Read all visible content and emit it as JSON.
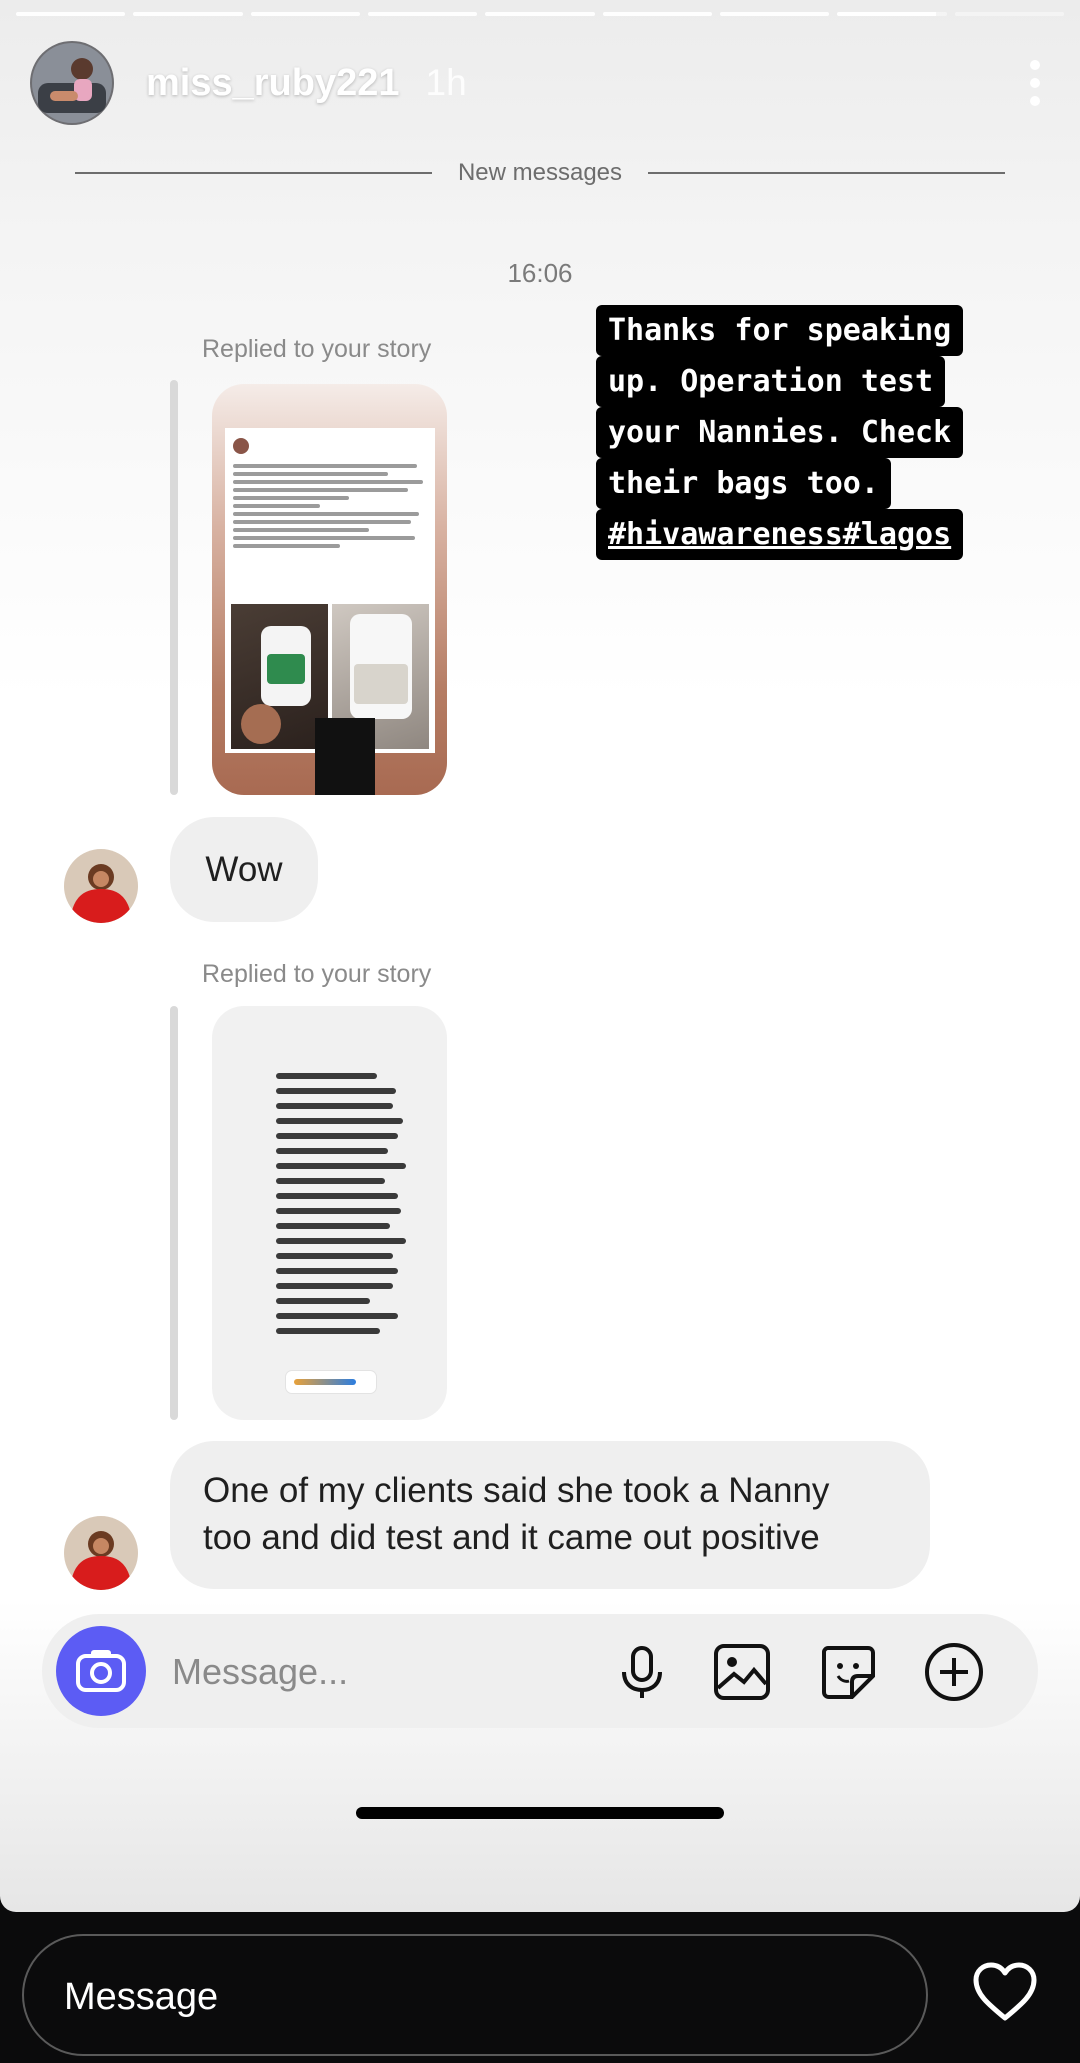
{
  "story": {
    "username": "miss_ruby221",
    "time": "1h",
    "segments": [
      "seen",
      "seen",
      "seen",
      "seen",
      "seen",
      "seen",
      "seen",
      "partial",
      "unseen"
    ]
  },
  "chat": {
    "divider": "New messages",
    "timestamp": "16:06",
    "replied_label_1": "Replied to your story",
    "replied_label_2": "Replied to your story",
    "bubble_1": "Wow",
    "bubble_2_line1": "One of my clients said she took a Nanny",
    "bubble_2_line2": "too and did test and it came out positive"
  },
  "overlay_text": {
    "line1": "Thanks for speaking",
    "line2": "up. Operation test",
    "line3": "your Nannies. Check",
    "line4": "their bags too.",
    "line5": "#hivawareness#lagos"
  },
  "composer": {
    "placeholder": "Message...",
    "icons": [
      "camera-icon",
      "microphone-icon",
      "gallery-icon",
      "sticker-icon",
      "add-icon"
    ],
    "camera_color": "#5c5cf4"
  },
  "reply_bar": {
    "placeholder": "Message",
    "icon": "heart-icon"
  }
}
